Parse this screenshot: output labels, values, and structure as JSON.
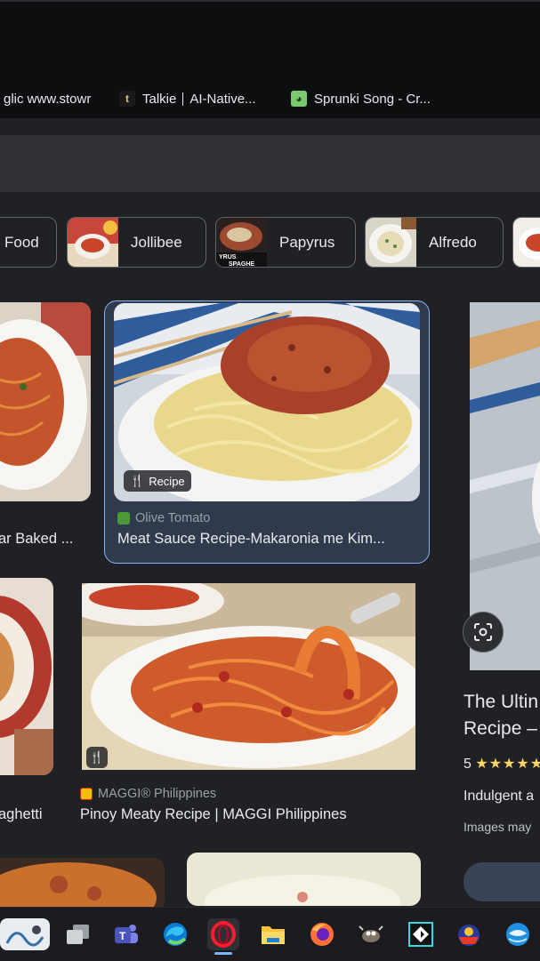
{
  "bookmarks": [
    {
      "label": "glic www.stowr",
      "icon": "none"
    },
    {
      "label": "Talkie",
      "extra": "AI-Native...",
      "icon": "talkie-icon"
    },
    {
      "label": "Sprunki Song - Cr...",
      "icon": "sprunki-icon"
    }
  ],
  "chips": [
    {
      "label": "Food"
    },
    {
      "label": "Jollibee"
    },
    {
      "label": "Papyrus"
    },
    {
      "label": "Alfredo"
    }
  ],
  "results": {
    "r1": {
      "title": "ar Baked ..."
    },
    "r2": {
      "badge": "Recipe",
      "source": "Olive Tomato",
      "title": "Meat Sauce Recipe-Makaronia me Kim..."
    },
    "r3": {
      "title": "aghetti"
    },
    "r4": {
      "source": "MAGGI® Philippines",
      "title": "Pinoy Meaty Recipe | MAGGI Philippines"
    }
  },
  "panel": {
    "title_line1": "The Ultin",
    "title_line2": "Recipe –",
    "rating": "5",
    "stars": "★★★★★",
    "description": "Indulgent a",
    "note": "Images may"
  },
  "taskbar": [
    {
      "name": "widgets-icon"
    },
    {
      "name": "task-view-icon"
    },
    {
      "name": "teams-icon"
    },
    {
      "name": "edge-icon"
    },
    {
      "name": "opera-icon"
    },
    {
      "name": "file-explorer-icon"
    },
    {
      "name": "firefox-icon"
    },
    {
      "name": "gimp-icon"
    },
    {
      "name": "inkscape-icon"
    },
    {
      "name": "app-icon"
    },
    {
      "name": "thunderbird-icon"
    }
  ],
  "colors": {
    "accent": "#8ab4f8",
    "background": "#1f2125",
    "star": "#fdd663"
  }
}
